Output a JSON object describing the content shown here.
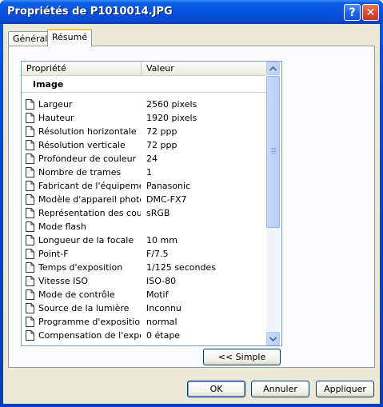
{
  "window": {
    "title": "Propriétés de P1010014.JPG",
    "help_label": "?",
    "close_label": "✕"
  },
  "tabs": [
    {
      "label": "Général",
      "active": false
    },
    {
      "label": "Résumé",
      "active": true
    }
  ],
  "list": {
    "columns": {
      "property": "Propriété",
      "value": "Valeur"
    },
    "group": "Image",
    "rows": [
      {
        "property": "Largeur",
        "value": "2560 pixels"
      },
      {
        "property": "Hauteur",
        "value": "1920 pixels"
      },
      {
        "property": "Résolution horizontale",
        "value": "72 ppp"
      },
      {
        "property": "Résolution verticale",
        "value": "72 ppp"
      },
      {
        "property": "Profondeur de couleur",
        "value": "24"
      },
      {
        "property": "Nombre de trames",
        "value": "1"
      },
      {
        "property": "Fabricant de l'équipement",
        "value": "Panasonic"
      },
      {
        "property": "Modèle d'appareil photo",
        "value": "DMC-FX7"
      },
      {
        "property": "Représentation des cou...",
        "value": "sRGB"
      },
      {
        "property": "Mode flash",
        "value": ""
      },
      {
        "property": "Longueur de la focale",
        "value": "10 mm"
      },
      {
        "property": "Point-F",
        "value": "F/7.5"
      },
      {
        "property": "Temps d'exposition",
        "value": "1/125 secondes"
      },
      {
        "property": "Vitesse ISO",
        "value": "ISO-80"
      },
      {
        "property": "Mode de contrôle",
        "value": "Motif"
      },
      {
        "property": "Source de la lumière",
        "value": "Inconnu"
      },
      {
        "property": "Programme d'exposition",
        "value": "normal"
      },
      {
        "property": "Compensation de l'expo...",
        "value": "0 étape"
      }
    ]
  },
  "buttons": {
    "simple": "<< Simple",
    "ok": "OK",
    "cancel": "Annuler",
    "apply": "Appliquer"
  },
  "icons": {
    "row_icon": "document-icon",
    "scroll_up": "arrow-up-icon",
    "scroll_down": "arrow-down-icon"
  },
  "colors": {
    "titlebar": "#0553e0",
    "close": "#d8452a",
    "dialog_bg": "#ece9d8",
    "tab_highlight": "#ffc83c"
  }
}
